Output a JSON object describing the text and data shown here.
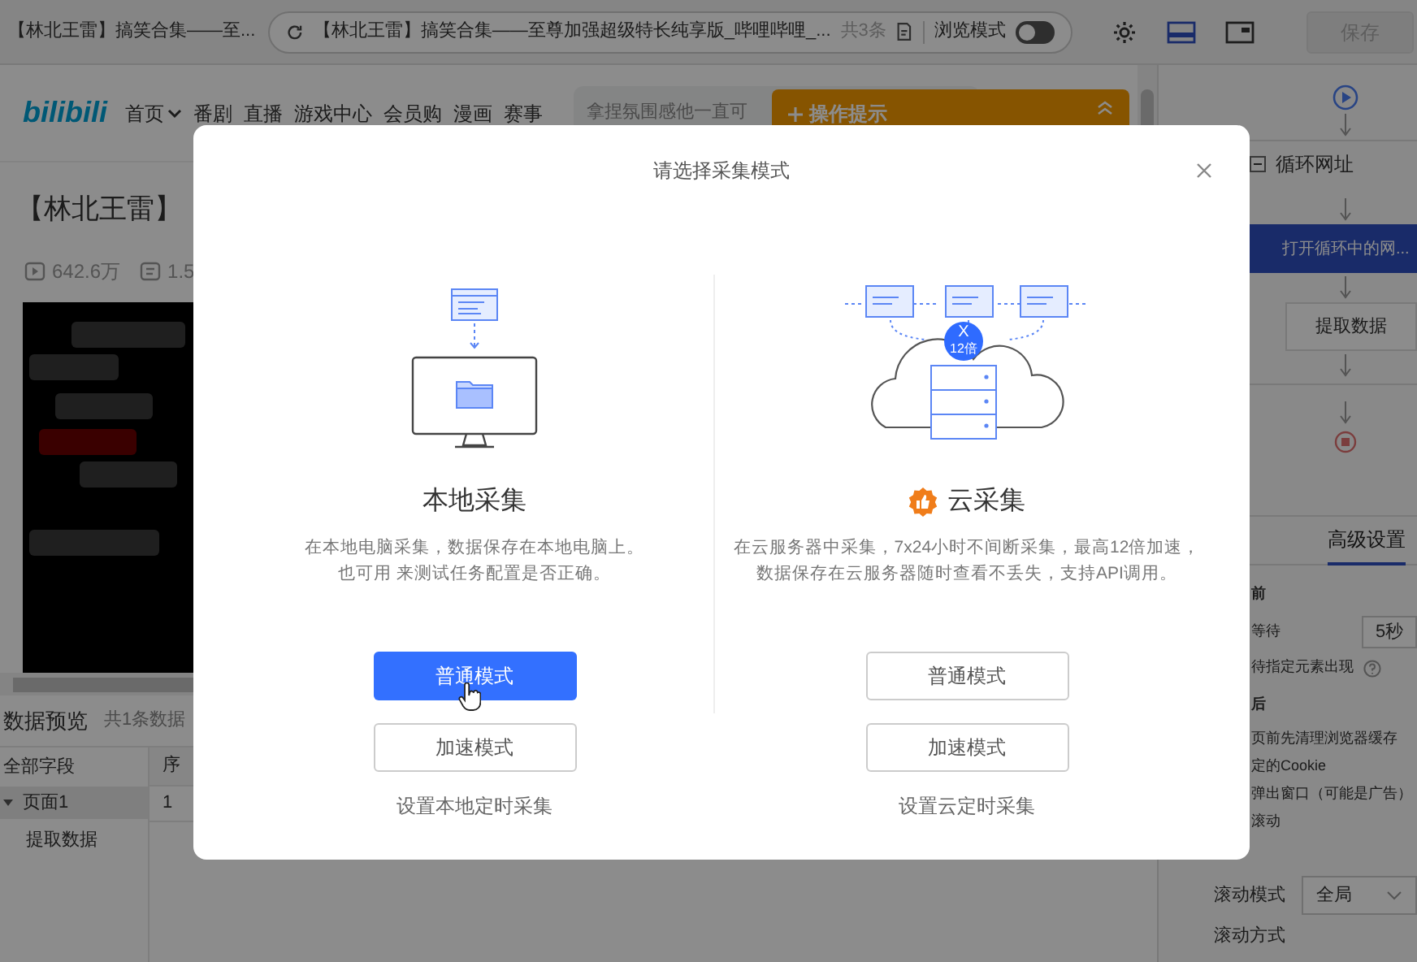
{
  "browser_tab": {
    "title": "【林北王雷】搞笑合集——至..."
  },
  "address_bar": {
    "url": "【林北王雷】搞笑合集——至尊加强超级特长纯享版_哔哩哔哩_...",
    "count": "共3条",
    "mode_label": "浏览模式",
    "mode_on": false
  },
  "save_button": {
    "label": "保存",
    "disabled": true
  },
  "site_nav": {
    "logo": "bilibili",
    "items": [
      {
        "label": "首页",
        "dropdown": true
      },
      {
        "label": "番剧",
        "dropdown": false
      },
      {
        "label": "直播",
        "dropdown": false
      },
      {
        "label": "游戏中心",
        "dropdown": false
      },
      {
        "label": "会员购",
        "dropdown": false
      },
      {
        "label": "漫画",
        "dropdown": false
      },
      {
        "label": "赛事",
        "dropdown": false
      }
    ],
    "search_placeholder": "拿捏氛围感他一直可"
  },
  "tip_panel": {
    "title": "操作提示",
    "collapsed": false
  },
  "video": {
    "title": "【林北王雷】",
    "views": "642.6万",
    "danmaku": "1.5"
  },
  "data_preview": {
    "title": "数据预览",
    "count": "共1条数据",
    "fields_header": "全部字段",
    "tree": [
      {
        "label": "页面1",
        "expanded": true,
        "selected": true,
        "children": [
          {
            "label": "提取数据",
            "selected": false
          }
        ]
      }
    ],
    "columns": [
      "序"
    ],
    "rows": [
      [
        "1"
      ]
    ]
  },
  "workflow": {
    "steps": [
      {
        "kind": "start"
      },
      {
        "kind": "loop",
        "label": "循环网址"
      },
      {
        "kind": "action",
        "label": "打开循环中的网...",
        "selected": true
      },
      {
        "kind": "action",
        "label": "提取数据",
        "selected": false
      },
      {
        "kind": "end"
      }
    ]
  },
  "settings": {
    "tabs": [
      {
        "label": "高级设置",
        "selected": true
      }
    ],
    "upper_rows": [
      {
        "kind": "heading",
        "label": "前"
      },
      {
        "kind": "field",
        "label": "等待",
        "value": "5秒"
      },
      {
        "kind": "help",
        "label": "待指定元素出现"
      },
      {
        "kind": "heading",
        "label": "后"
      },
      {
        "kind": "text",
        "label": "页前先清理浏览器缓存"
      },
      {
        "kind": "text",
        "label": "定的Cookie"
      },
      {
        "kind": "text",
        "label": "弹出窗口（可能是广告）"
      },
      {
        "kind": "text",
        "label": "滚动"
      }
    ],
    "lower_rows": [
      {
        "kind": "select",
        "label": "滚动模式",
        "value": "全局"
      },
      {
        "kind": "text",
        "label": "滚动方式"
      }
    ]
  },
  "dialog": {
    "title": "请选择采集模式",
    "modes": [
      {
        "kind": "local",
        "title": "本地采集",
        "description": [
          "在本地电脑采集，数据保存在本地电脑上。",
          "也可用 来测试任务配置是否正确。"
        ],
        "buttons": [
          {
            "label": "普通模式",
            "primary": true
          },
          {
            "label": "加速模式",
            "primary": false
          }
        ],
        "link": "设置本地定时采集"
      },
      {
        "kind": "cloud",
        "title": "云采集",
        "badge": [
          "X",
          "12倍"
        ],
        "description": [
          "在云服务器中采集，7x24小时不间断采集，最高12倍加速，",
          "数据保存在云服务器随时查看不丢失，支持API调用。"
        ],
        "buttons": [
          {
            "label": "普通模式",
            "primary": false
          },
          {
            "label": "加速模式",
            "primary": false
          }
        ],
        "link": "设置云定时采集"
      }
    ]
  }
}
